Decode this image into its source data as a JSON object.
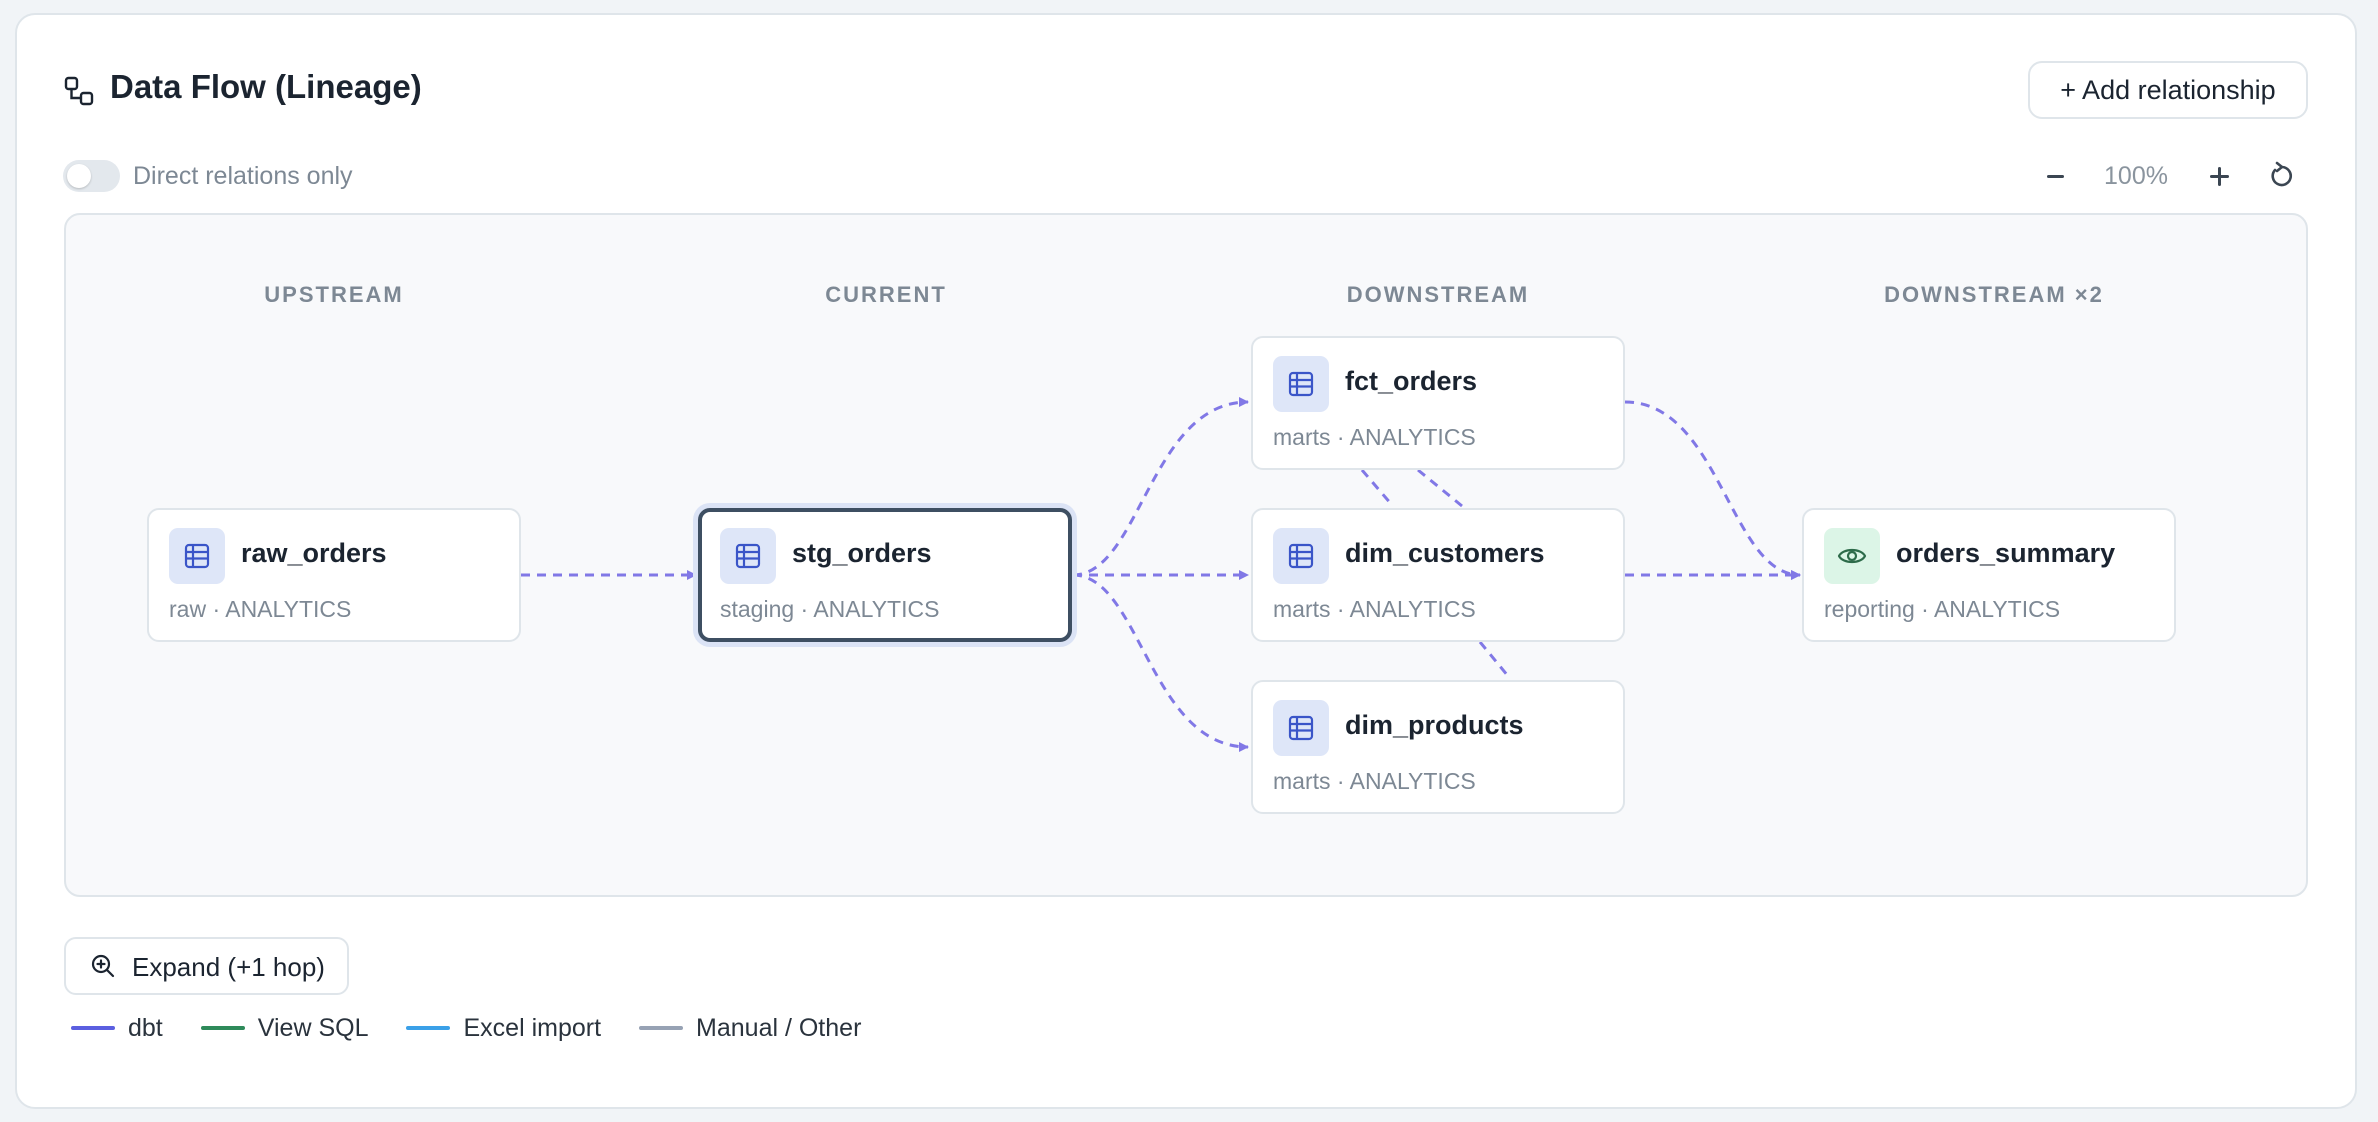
{
  "header": {
    "title": "Data Flow (Lineage)",
    "add_button": "+ Add relationship"
  },
  "toolbar": {
    "direct_only_label": "Direct relations only",
    "direct_only_on": false,
    "zoom_value": "100%"
  },
  "columns": [
    "UPSTREAM",
    "CURRENT",
    "DOWNSTREAM",
    "DOWNSTREAM ×2"
  ],
  "nodes": {
    "raw_orders": {
      "name": "raw_orders",
      "meta": "raw · ANALYTICS",
      "icon": "table-icon"
    },
    "stg_orders": {
      "name": "stg_orders",
      "meta": "staging · ANALYTICS",
      "icon": "table-icon"
    },
    "fct_orders": {
      "name": "fct_orders",
      "meta": "marts · ANALYTICS",
      "icon": "table-icon"
    },
    "dim_customers": {
      "name": "dim_customers",
      "meta": "marts · ANALYTICS",
      "icon": "table-icon"
    },
    "dim_products": {
      "name": "dim_products",
      "meta": "marts · ANALYTICS",
      "icon": "table-icon"
    },
    "orders_summary": {
      "name": "orders_summary",
      "meta": "reporting · ANALYTICS",
      "icon": "eye-icon"
    }
  },
  "footer": {
    "expand_button": "Expand (+1 hop)"
  },
  "legend": [
    {
      "label": "dbt",
      "color": "#5b5fe0"
    },
    {
      "label": "View SQL",
      "color": "#2e8a5a"
    },
    {
      "label": "Excel import",
      "color": "#3aa0e8"
    },
    {
      "label": "Manual / Other",
      "color": "#97a2b4"
    }
  ],
  "colors": {
    "edge": "#8178e6",
    "current_border": "#3e4f62",
    "table_icon": "#3a55c8",
    "view_icon": "#2d6b4a"
  }
}
